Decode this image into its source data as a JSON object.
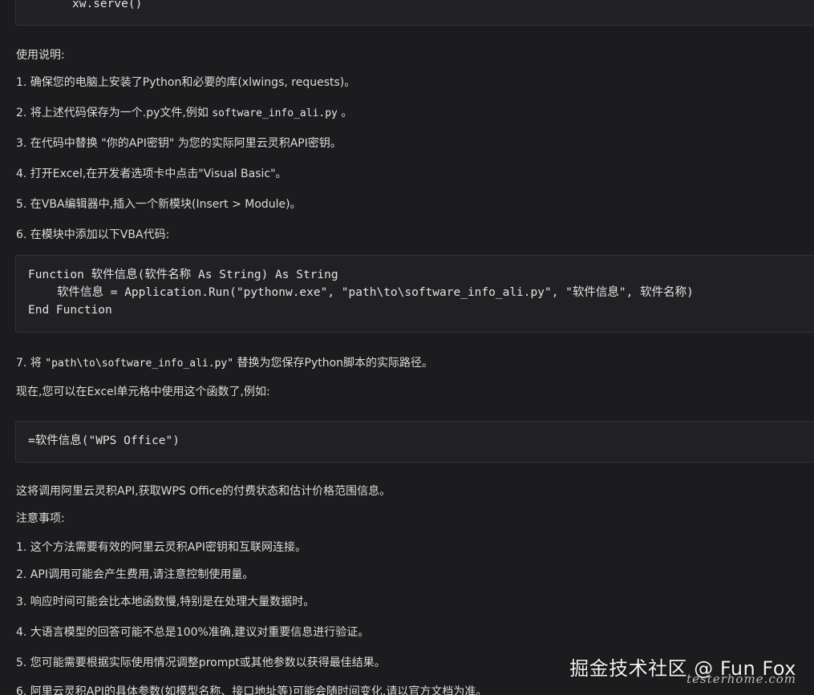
{
  "top_code": {
    "line": "xw.serve()"
  },
  "usage_heading": "使用说明:",
  "steps": [
    "1. 确保您的电脑上安装了Python和必要的库(xlwings, requests)。",
    "2. 将上述代码保存为一个.py文件,例如 ",
    "3. 在代码中替换 \"你的API密钥\" 为您的实际阿里云灵积API密钥。",
    "4. 打开Excel,在开发者选项卡中点击\"Visual Basic\"。",
    "5. 在VBA编辑器中,插入一个新模块(Insert > Module)。",
    "6. 在模块中添加以下VBA代码:"
  ],
  "step2_code": "software_info_ali.py",
  "step2_suffix": " 。",
  "vba_code": {
    "line1": "Function 软件信息(软件名称 As String) As String",
    "line2": "软件信息 = Application.Run(\"pythonw.exe\", \"path\\to\\software_info_ali.py\", \"软件信息\", 软件名称)",
    "line3": "End Function"
  },
  "step7_prefix": "7. 将 ",
  "step7_code": "\"path\\to\\software_info_ali.py\"",
  "step7_suffix": " 替换为您保存Python脚本的实际路径。",
  "now_text": "现在,您可以在Excel单元格中使用这个函数了,例如:",
  "formula_code": "=软件信息(\"WPS Office\")",
  "explain_text": "这将调用阿里云灵积API,获取WPS Office的付费状态和估计价格范围信息。",
  "notes_heading": "注意事项:",
  "notes": [
    "1. 这个方法需要有效的阿里云灵积API密钥和互联网连接。",
    "2. API调用可能会产生费用,请注意控制使用量。",
    "3. 响应时间可能会比本地函数慢,特别是在处理大量数据时。",
    "4. 大语言模型的回答可能不总是100%准确,建议对重要信息进行验证。",
    "5. 您可能需要根据实际使用情况调整prompt或其他参数以获得最佳结果。",
    "6. 阿里云灵积API的具体参数(如模型名称、接口地址等)可能会随时间变化,请以官方文档为准。"
  ],
  "watermark": {
    "main": "掘金技术社区 @ Fun Fox",
    "sub": "testerhome.com"
  }
}
